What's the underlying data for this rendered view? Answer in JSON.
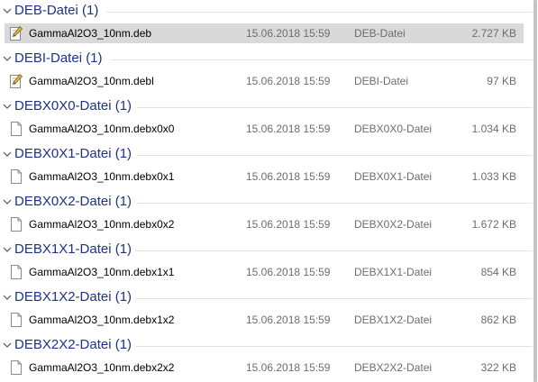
{
  "groups": [
    {
      "title": "DEB-Datei (1)",
      "icon": "editable-document-icon",
      "file": {
        "name": "GammaAl2O3_10nm.deb",
        "date": "15.06.2018 15:59",
        "type": "DEB-Datei",
        "size": "2.727 KB",
        "selected": true
      }
    },
    {
      "title": "DEBI-Datei (1)",
      "icon": "editable-document-icon",
      "file": {
        "name": "GammaAl2O3_10nm.debl",
        "date": "15.06.2018 15:59",
        "type": "DEBI-Datei",
        "size": "97 KB",
        "selected": false
      }
    },
    {
      "title": "DEBX0X0-Datei (1)",
      "icon": "blank-file-icon",
      "file": {
        "name": "GammaAl2O3_10nm.debx0x0",
        "date": "15.06.2018 15:59",
        "type": "DEBX0X0-Datei",
        "size": "1.034 KB",
        "selected": false
      }
    },
    {
      "title": "DEBX0X1-Datei (1)",
      "icon": "blank-file-icon",
      "file": {
        "name": "GammaAl2O3_10nm.debx0x1",
        "date": "15.06.2018 15:59",
        "type": "DEBX0X1-Datei",
        "size": "1.033 KB",
        "selected": false
      }
    },
    {
      "title": "DEBX0X2-Datei (1)",
      "icon": "blank-file-icon",
      "file": {
        "name": "GammaAl2O3_10nm.debx0x2",
        "date": "15.06.2018 15:59",
        "type": "DEBX0X2-Datei",
        "size": "1.672 KB",
        "selected": false
      }
    },
    {
      "title": "DEBX1X1-Datei (1)",
      "icon": "blank-file-icon",
      "file": {
        "name": "GammaAl2O3_10nm.debx1x1",
        "date": "15.06.2018 15:59",
        "type": "DEBX1X1-Datei",
        "size": "854 KB",
        "selected": false
      }
    },
    {
      "title": "DEBX1X2-Datei (1)",
      "icon": "blank-file-icon",
      "file": {
        "name": "GammaAl2O3_10nm.debx1x2",
        "date": "15.06.2018 15:59",
        "type": "DEBX1X2-Datei",
        "size": "862 KB",
        "selected": false
      }
    },
    {
      "title": "DEBX2X2-Datei (1)",
      "icon": "blank-file-icon",
      "file": {
        "name": "GammaAl2O3_10nm.debx2x2",
        "date": "15.06.2018 15:59",
        "type": "DEBX2X2-Datei",
        "size": "322 KB",
        "selected": false
      }
    }
  ],
  "colors": {
    "group_title": "#1e3287",
    "selected_row": "#d9d9d9",
    "secondary_text": "#6d6d6d",
    "divider": "#e2e2e2"
  }
}
